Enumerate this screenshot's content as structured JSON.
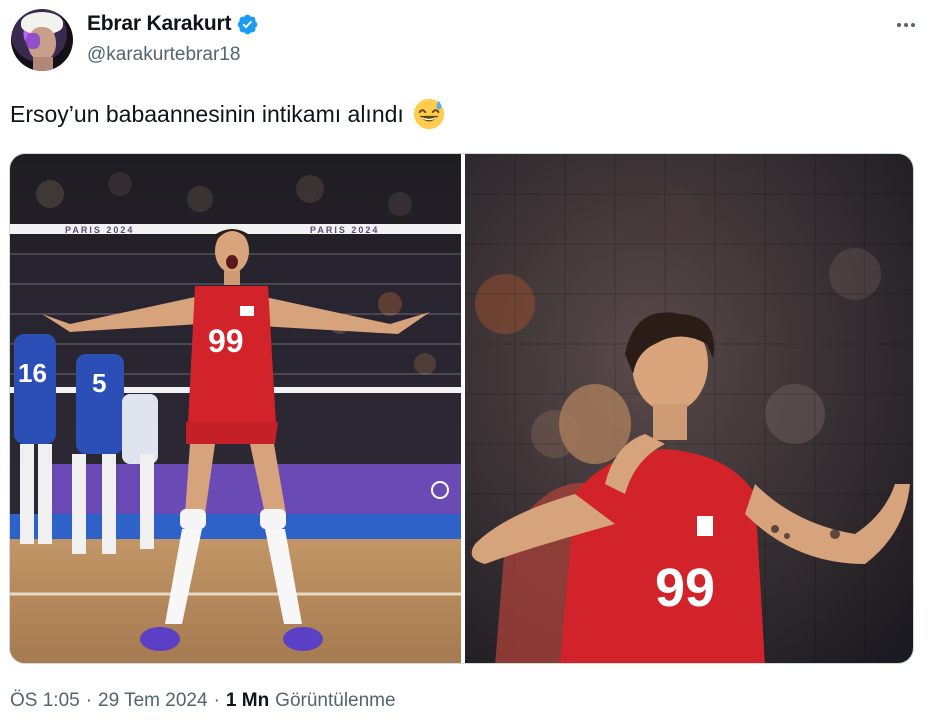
{
  "author": {
    "display_name": "Ebrar Karakurt",
    "handle": "@karakurtebrar18",
    "verified": true,
    "verified_color": "#1d9bf0"
  },
  "tweet": {
    "text": "Ersoy’un babaannesinin intikamı alındı",
    "emoji": "grinning-face-with-sweat"
  },
  "media": {
    "photos": [
      {
        "kind": "volleyball-player-celebrating-arms-spread",
        "jersey_number": "99",
        "net_banner_text": "PARIS 2024",
        "opponent_numbers": [
          "16",
          "5"
        ]
      },
      {
        "kind": "volleyball-player-closeup-fists-raised",
        "jersey_number": "99"
      }
    ]
  },
  "meta": {
    "time": "ÖS 1:05",
    "date": "29 Tem 2024",
    "views": "1 Mn",
    "views_label": "Görüntülenme"
  },
  "colors": {
    "jersey_red": "#d2232a",
    "secondary_text": "#536471",
    "text": "#0f1419"
  },
  "icons": {
    "more": "more-horizontal-icon",
    "verified": "verified-badge-icon"
  }
}
